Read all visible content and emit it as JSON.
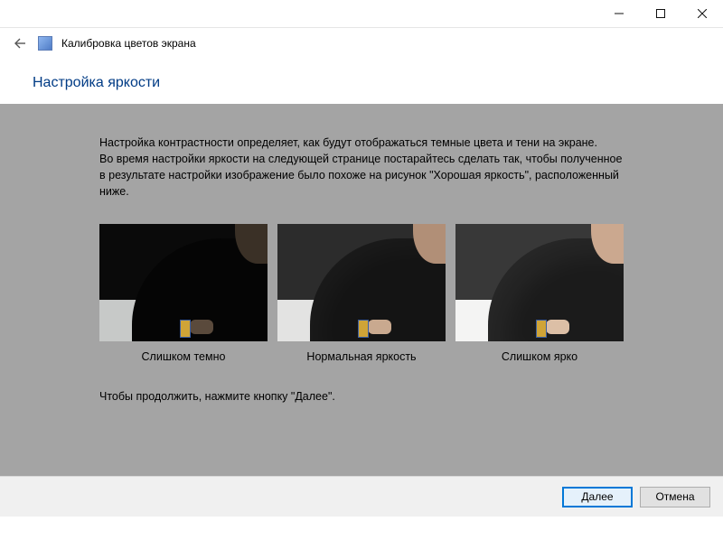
{
  "window": {
    "app_title": "Калибровка цветов экрана"
  },
  "page": {
    "title": "Настройка яркости",
    "instruction_p1": "Настройка контрастности определяет, как будут отображаться темные цвета и тени на экране.",
    "instruction_p2": "Во время настройки яркости на следующей странице постарайтесь сделать так, чтобы полученное в результате настройки изображение было похоже на рисунок \"Хорошая яркость\", расположенный ниже.",
    "continue_hint": "Чтобы продолжить, нажмите кнопку \"Далее\"."
  },
  "thumbs": {
    "too_dark": {
      "label": "Слишком темно"
    },
    "normal": {
      "label": "Нормальная яркость"
    },
    "too_bright": {
      "label": "Слишком ярко"
    }
  },
  "buttons": {
    "next": "Далее",
    "cancel": "Отмена"
  }
}
